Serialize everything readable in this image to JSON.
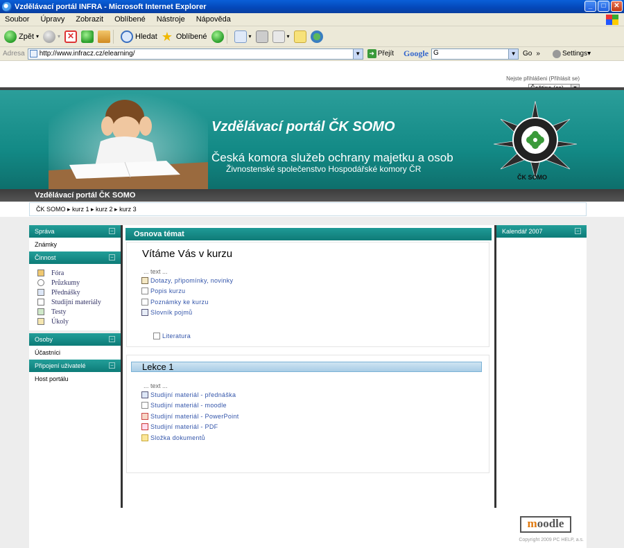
{
  "window": {
    "title": "Vzdělávací portál INFRA - Microsoft Internet Explorer",
    "btn_min": "_",
    "btn_max": "□",
    "btn_close": "✕"
  },
  "menu": [
    "Soubor",
    "Úpravy",
    "Zobrazit",
    "Oblíbené",
    "Nástroje",
    "Nápověda"
  ],
  "toolbar": {
    "back": "Zpět",
    "search": "Hledat",
    "favorites": "Oblíbené"
  },
  "address": {
    "label": "Adresa",
    "url": "http://www.infracz.cz/elearning/",
    "go": "Přejít",
    "google": "Google",
    "google_value": "G",
    "go_small": "Go",
    "more": "»",
    "settings": "Settings▾"
  },
  "page": {
    "login_info": "Nejste přihlášeni (Přihlásit se)",
    "language": "Čeština (cs)",
    "banner_title": "Vzdělávací portál ČK SOMO",
    "banner_sub1": "Česká komora služeb ochrany majetku a osob",
    "banner_sub2": "Živnostenské společenstvo Hospodářské komory ČR",
    "emblem_label": "ČK SOMO",
    "site_title": "Vzdělávací portál ČK SOMO",
    "breadcrumb": "ČK SOMO ▸ kurz 1 ▸ kurz 2 ▸ kurz 3"
  },
  "left": {
    "admin_head": "Správa",
    "admin_item": "Známky",
    "activity_head": "Činnost",
    "activities": [
      "Fóra",
      "Průzkumy",
      "Přednášky",
      "Studijní materiály",
      "Testy",
      "Úkoly"
    ],
    "people_head": "Osoby",
    "people_item": "Účastníci",
    "online_head": "Připojení uživatelé",
    "online_item": "Host portálu"
  },
  "center": {
    "head": "Osnova témat",
    "welcome": "Vítáme Vás v kurzu",
    "text_label": "... text ...",
    "items0": [
      "Dotazy, připomínky, novinky",
      "Popis kurzu",
      "Poznámky ke kurzu",
      "Slovník pojmů"
    ],
    "lit": "Literatura",
    "lekce": "Lekce 1",
    "text_label2": "... text ...",
    "items1": [
      "Studijní materiál - přednáška",
      "Studijní materiál - moodle",
      "Studijní materiál - PowerPoint",
      "Studijní materiál - PDF",
      "Složka dokumentů"
    ]
  },
  "right": {
    "calendar": "Kalendář 2007"
  },
  "footer": {
    "logo_m": "m",
    "logo_rest": "oodle",
    "copyright": "Copyright 2009 PC HELP, a.s."
  },
  "colors": {
    "teal": "#138a86",
    "dark": "#333333",
    "xp_blue": "#0447b8"
  }
}
